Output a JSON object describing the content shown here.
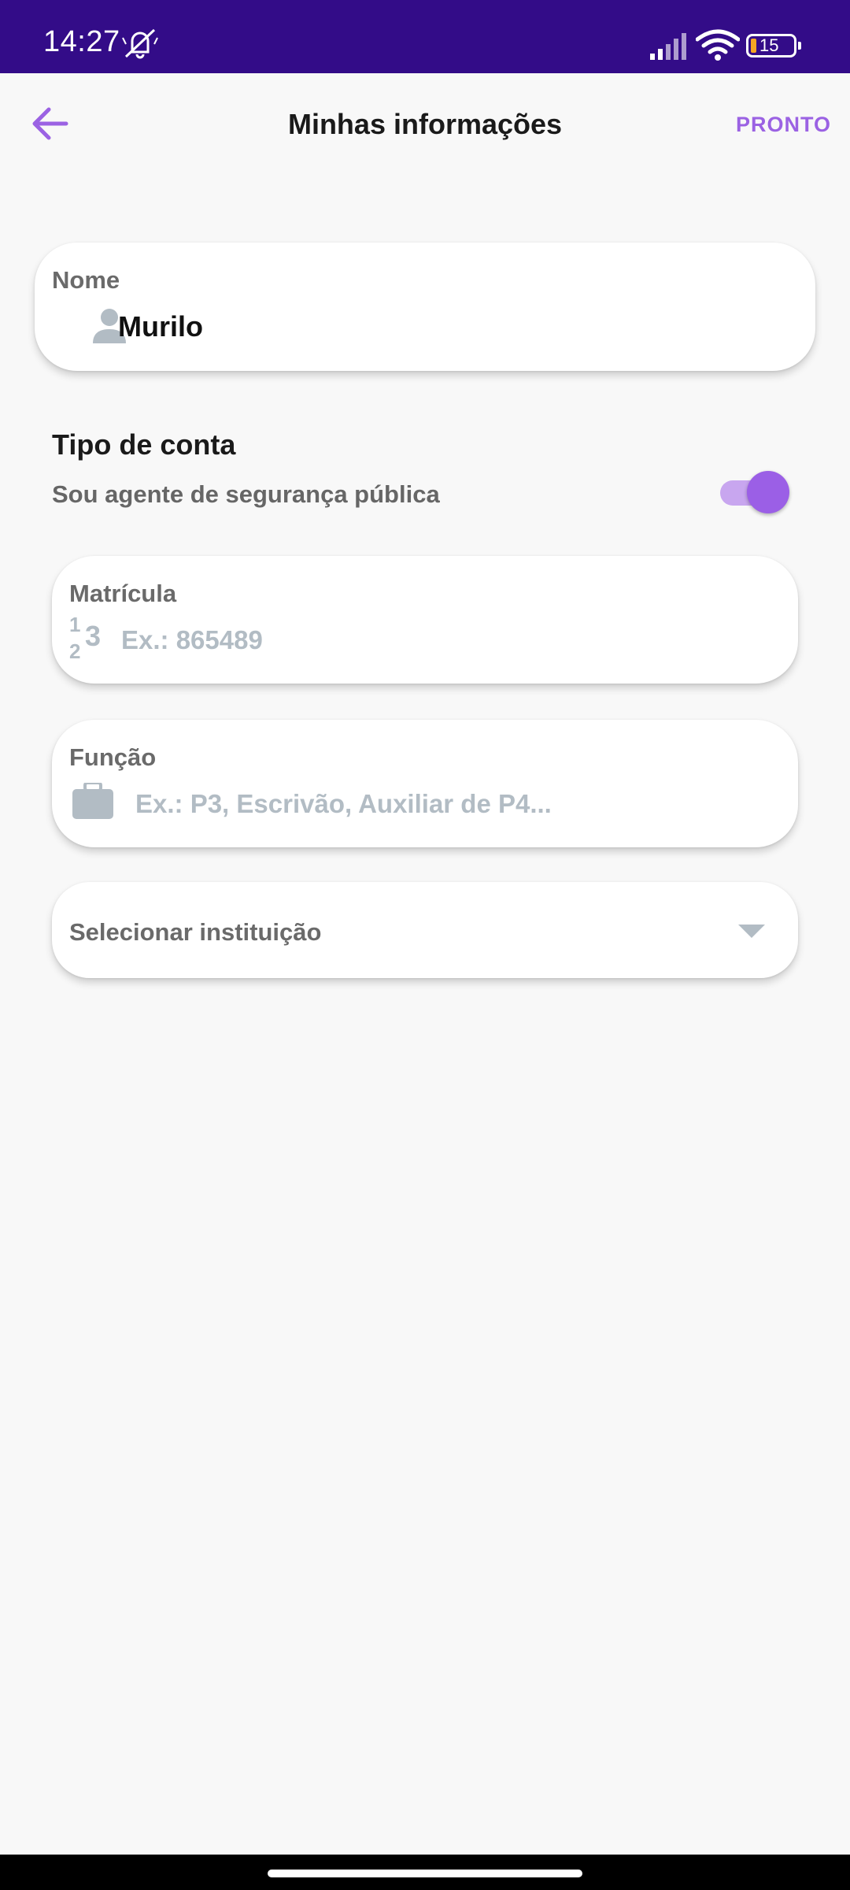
{
  "status_bar": {
    "time": "14:27",
    "battery_level": "15",
    "icons": [
      "bell-off-icon",
      "signal-icon",
      "wifi-icon",
      "battery-icon"
    ]
  },
  "header": {
    "title": "Minhas informações",
    "back_icon": "arrow-left-icon",
    "done_label": "PRONTO",
    "accent_color": "#9b62e3"
  },
  "name_field": {
    "label": "Nome",
    "value": "Murilo",
    "icon": "person-icon"
  },
  "account_type": {
    "title": "Tipo de conta",
    "toggle_label": "Sou agente de segurança pública",
    "toggle_on": true
  },
  "registration_field": {
    "label": "Matrícula",
    "placeholder": "Ex.: 865489",
    "icon": "numeric-icon",
    "icon_glyph": "123"
  },
  "role_field": {
    "label": "Função",
    "placeholder": "Ex.: P3, Escrivão, Auxiliar de P4...",
    "icon": "briefcase-icon"
  },
  "institution_select": {
    "label": "Selecionar instituição",
    "icon": "chevron-down-icon"
  },
  "colors": {
    "status_bar": "#330c88",
    "accent": "#9b62e3",
    "placeholder": "#b2bcc4",
    "background": "#f8f8f8"
  }
}
